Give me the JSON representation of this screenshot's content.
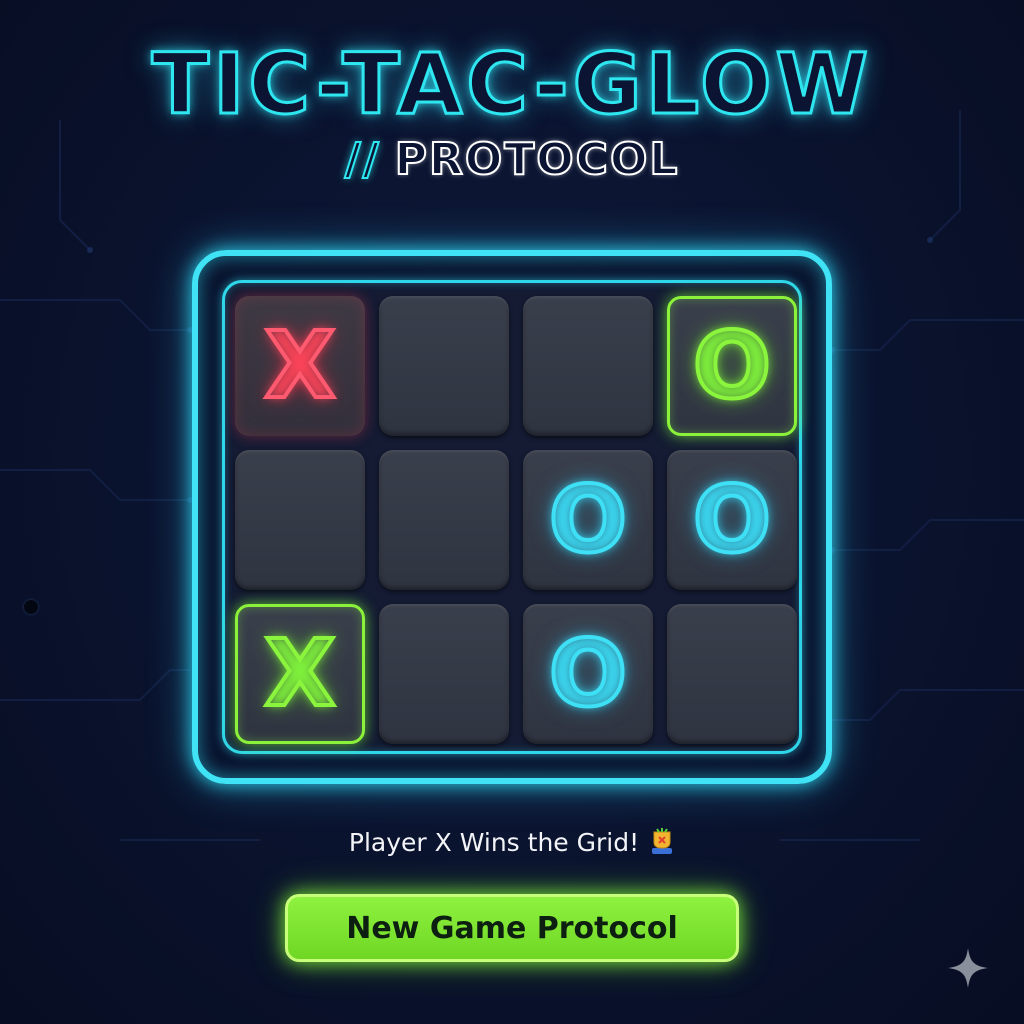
{
  "game": {
    "title": "TIC-TAC-GLOW",
    "subtitle_slashes": "//",
    "subtitle_word": "PROTOCOL"
  },
  "board": {
    "rows": 3,
    "cols": 4,
    "cells": [
      {
        "mark": "X",
        "color": "red",
        "highlight": "red"
      },
      {
        "mark": "",
        "color": "",
        "highlight": ""
      },
      {
        "mark": "",
        "color": "",
        "highlight": ""
      },
      {
        "mark": "O",
        "color": "green",
        "highlight": "green"
      },
      {
        "mark": "",
        "color": "",
        "highlight": ""
      },
      {
        "mark": "",
        "color": "",
        "highlight": ""
      },
      {
        "mark": "O",
        "color": "cyan",
        "highlight": ""
      },
      {
        "mark": "O",
        "color": "cyan",
        "highlight": ""
      },
      {
        "mark": "X",
        "color": "green",
        "highlight": "green"
      },
      {
        "mark": "",
        "color": "",
        "highlight": ""
      },
      {
        "mark": "O",
        "color": "cyan",
        "highlight": ""
      },
      {
        "mark": "",
        "color": "",
        "highlight": ""
      }
    ]
  },
  "status": {
    "text": "Player X Wins the Grid!",
    "icon": "trophy-icon"
  },
  "new_game_button": {
    "label": "New Game Protocol"
  },
  "colors": {
    "background": "#0b1430",
    "neon_cyan": "#3ee0f6",
    "neon_green": "#8af53c",
    "neon_red": "#ff5a70",
    "cell": "#343946"
  }
}
